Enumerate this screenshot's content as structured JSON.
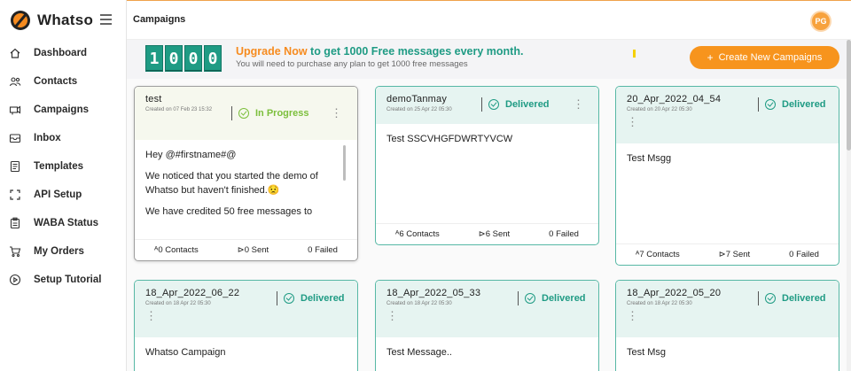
{
  "app": {
    "name": "Whatso"
  },
  "sidebar": {
    "items": [
      {
        "label": "Dashboard",
        "icon": "home-icon"
      },
      {
        "label": "Contacts",
        "icon": "contacts-icon"
      },
      {
        "label": "Campaigns",
        "icon": "campaigns-icon"
      },
      {
        "label": "Inbox",
        "icon": "inbox-icon"
      },
      {
        "label": "Templates",
        "icon": "templates-icon"
      },
      {
        "label": "API Setup",
        "icon": "api-icon"
      },
      {
        "label": "WABA Status",
        "icon": "waba-icon"
      },
      {
        "label": "My Orders",
        "icon": "cart-icon"
      },
      {
        "label": "Setup Tutorial",
        "icon": "play-icon"
      }
    ]
  },
  "header": {
    "title": "Campaigns",
    "avatar_initials": "PG"
  },
  "banner": {
    "digits": [
      "1",
      "0",
      "0",
      "0"
    ],
    "upgrade_link": "Upgrade Now",
    "upgrade_text_1": " to get ",
    "upgrade_highlight": "1000 Free messages",
    "upgrade_text_2": " every month.",
    "subtext": "You will need to purchase any plan to get 1000 free messages",
    "create_button": "Create New Campaigns"
  },
  "campaigns": [
    {
      "name": "test",
      "created": "Created on 07 Feb 23 15:32",
      "status": "In Progress",
      "message": [
        "Hey @#firstname#@",
        "We noticed that you started the demo of Whatso but haven't finished.😟",
        "We have credited 50 free messages to"
      ],
      "contacts": "0 Contacts",
      "sent": "0 Sent",
      "failed": "0 Failed"
    },
    {
      "name": "demoTanmay",
      "created": "Created on 25 Apr 22 05:30",
      "status": "Delivered",
      "message": [
        "Test SSCVHGFDWRTYVCW"
      ],
      "contacts": "6 Contacts",
      "sent": "6 Sent",
      "failed": "0 Failed"
    },
    {
      "name": "20_Apr_2022_04_54",
      "created": "Created on 20 Apr 22 05:30",
      "status": "Delivered",
      "message": [
        "Test Msgg"
      ],
      "contacts": "7 Contacts",
      "sent": "7 Sent",
      "failed": "0 Failed"
    },
    {
      "name": "18_Apr_2022_06_22",
      "created": "Created on 18 Apr 22 05:30",
      "status": "Delivered",
      "message": [
        "Whatso Campaign"
      ]
    },
    {
      "name": "18_Apr_2022_05_33",
      "created": "Created on 18 Apr 22 05:30",
      "status": "Delivered",
      "message": [
        "Test Message.."
      ]
    },
    {
      "name": "18_Apr_2022_05_20",
      "created": "Created on 18 Apr 22 05:30",
      "status": "Delivered",
      "message": [
        "Test Msg"
      ]
    }
  ]
}
